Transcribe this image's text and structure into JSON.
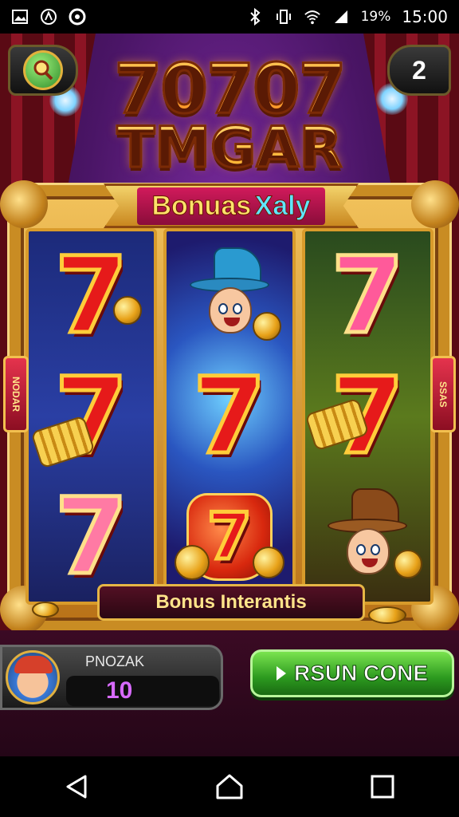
{
  "status_bar": {
    "battery": "19%",
    "time": "15:00"
  },
  "game": {
    "title_line1": "70707",
    "title_line2": "TMGAR",
    "ribbon_part1": "Bonuas",
    "ribbon_part2": "Xaly",
    "side_tag_left": "NODAR",
    "side_tag_right": "SSAS",
    "bottom_banner": "Bonus Interantis",
    "top_right_button": "2",
    "player_label": "PNOZAK",
    "player_value": "10",
    "spin_button_label": "RSUN CONE"
  },
  "reels": [
    [
      "red-seven",
      "red-seven-coins",
      "pink-seven"
    ],
    [
      "wizard-face",
      "red-seven",
      "red-seven-moneybag"
    ],
    [
      "pink-seven",
      "red-seven-coins",
      "cowboy-face"
    ]
  ],
  "colors": {
    "accent_gold": "#c98c23",
    "spin_green": "#2c9a1f",
    "player_value": "#d76aff"
  }
}
